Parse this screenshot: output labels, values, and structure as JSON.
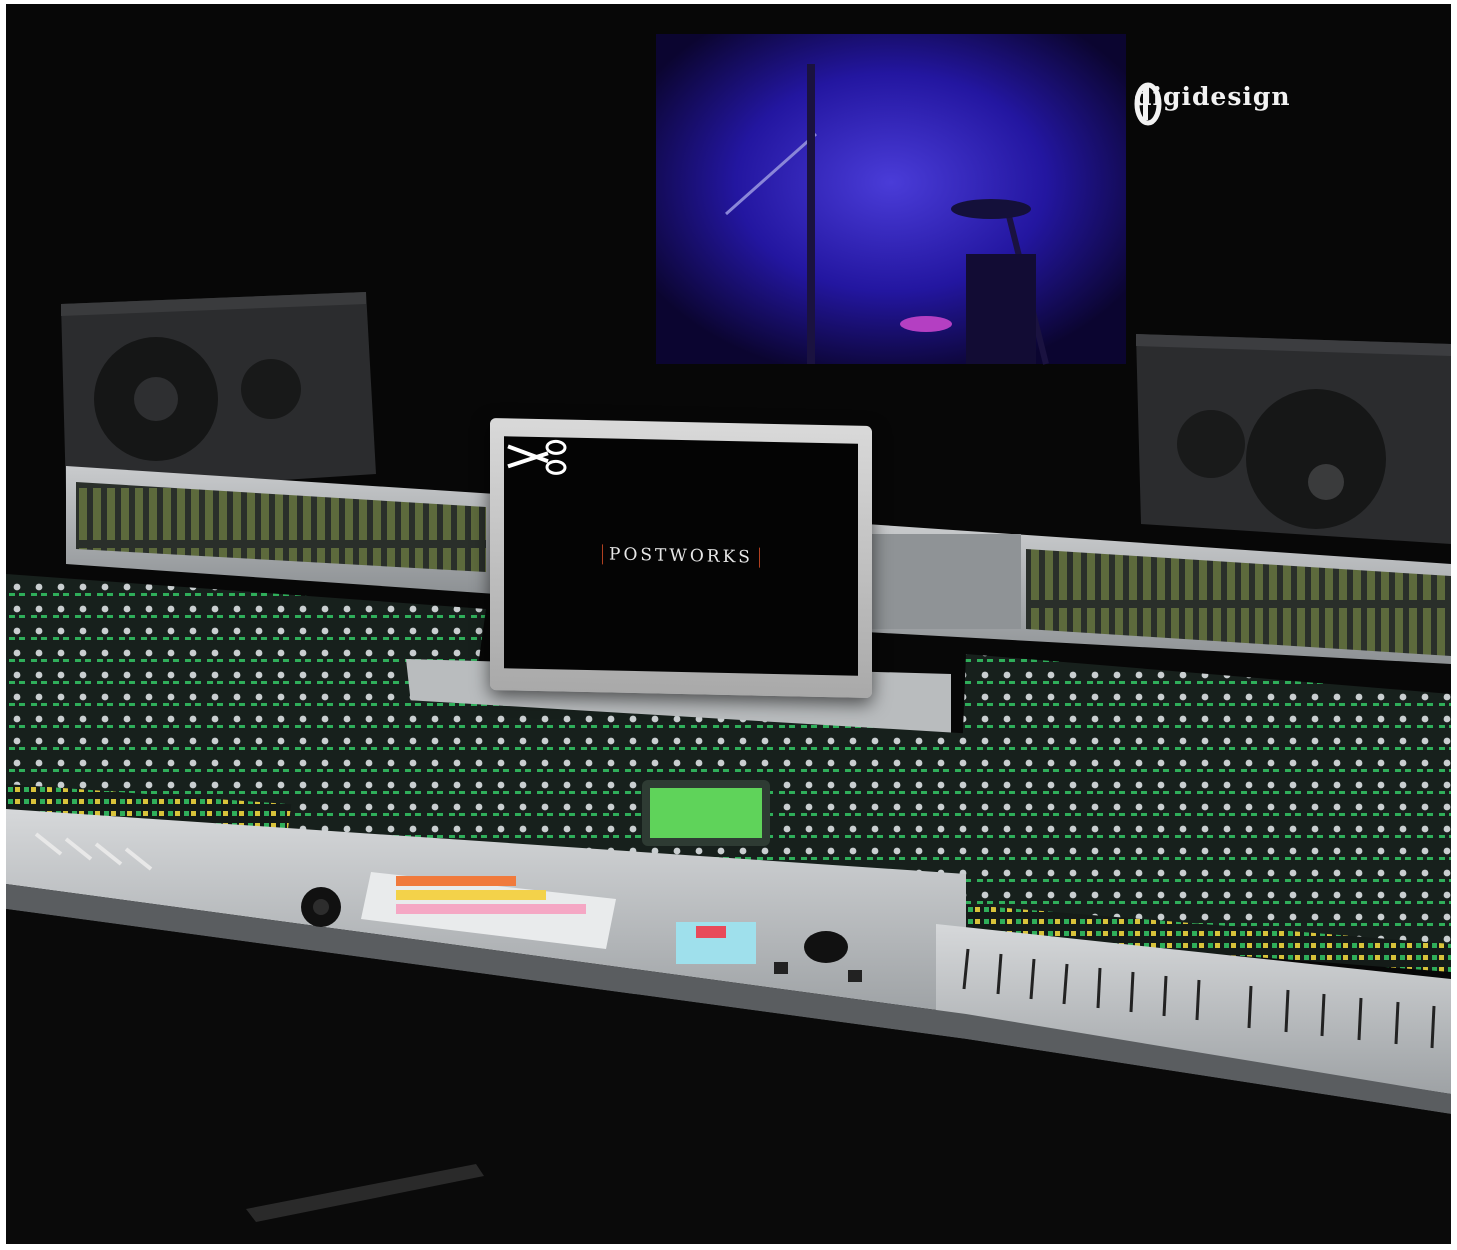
{
  "brand": {
    "name": "digidesign",
    "logo_icon": "digidesign-logo-icon"
  },
  "monitor": {
    "screen_text": "POSTWORKS",
    "screen_icon": "scissors-icon"
  },
  "colors": {
    "window_glow": "#2a1fb0",
    "console_panel": "#1b2420",
    "console_surface": "#c4c7c9",
    "led_green": "#2fae5a",
    "led_red": "#d4302a",
    "led_yellow": "#d8c23a",
    "overview_screen": "#5fd35a"
  }
}
